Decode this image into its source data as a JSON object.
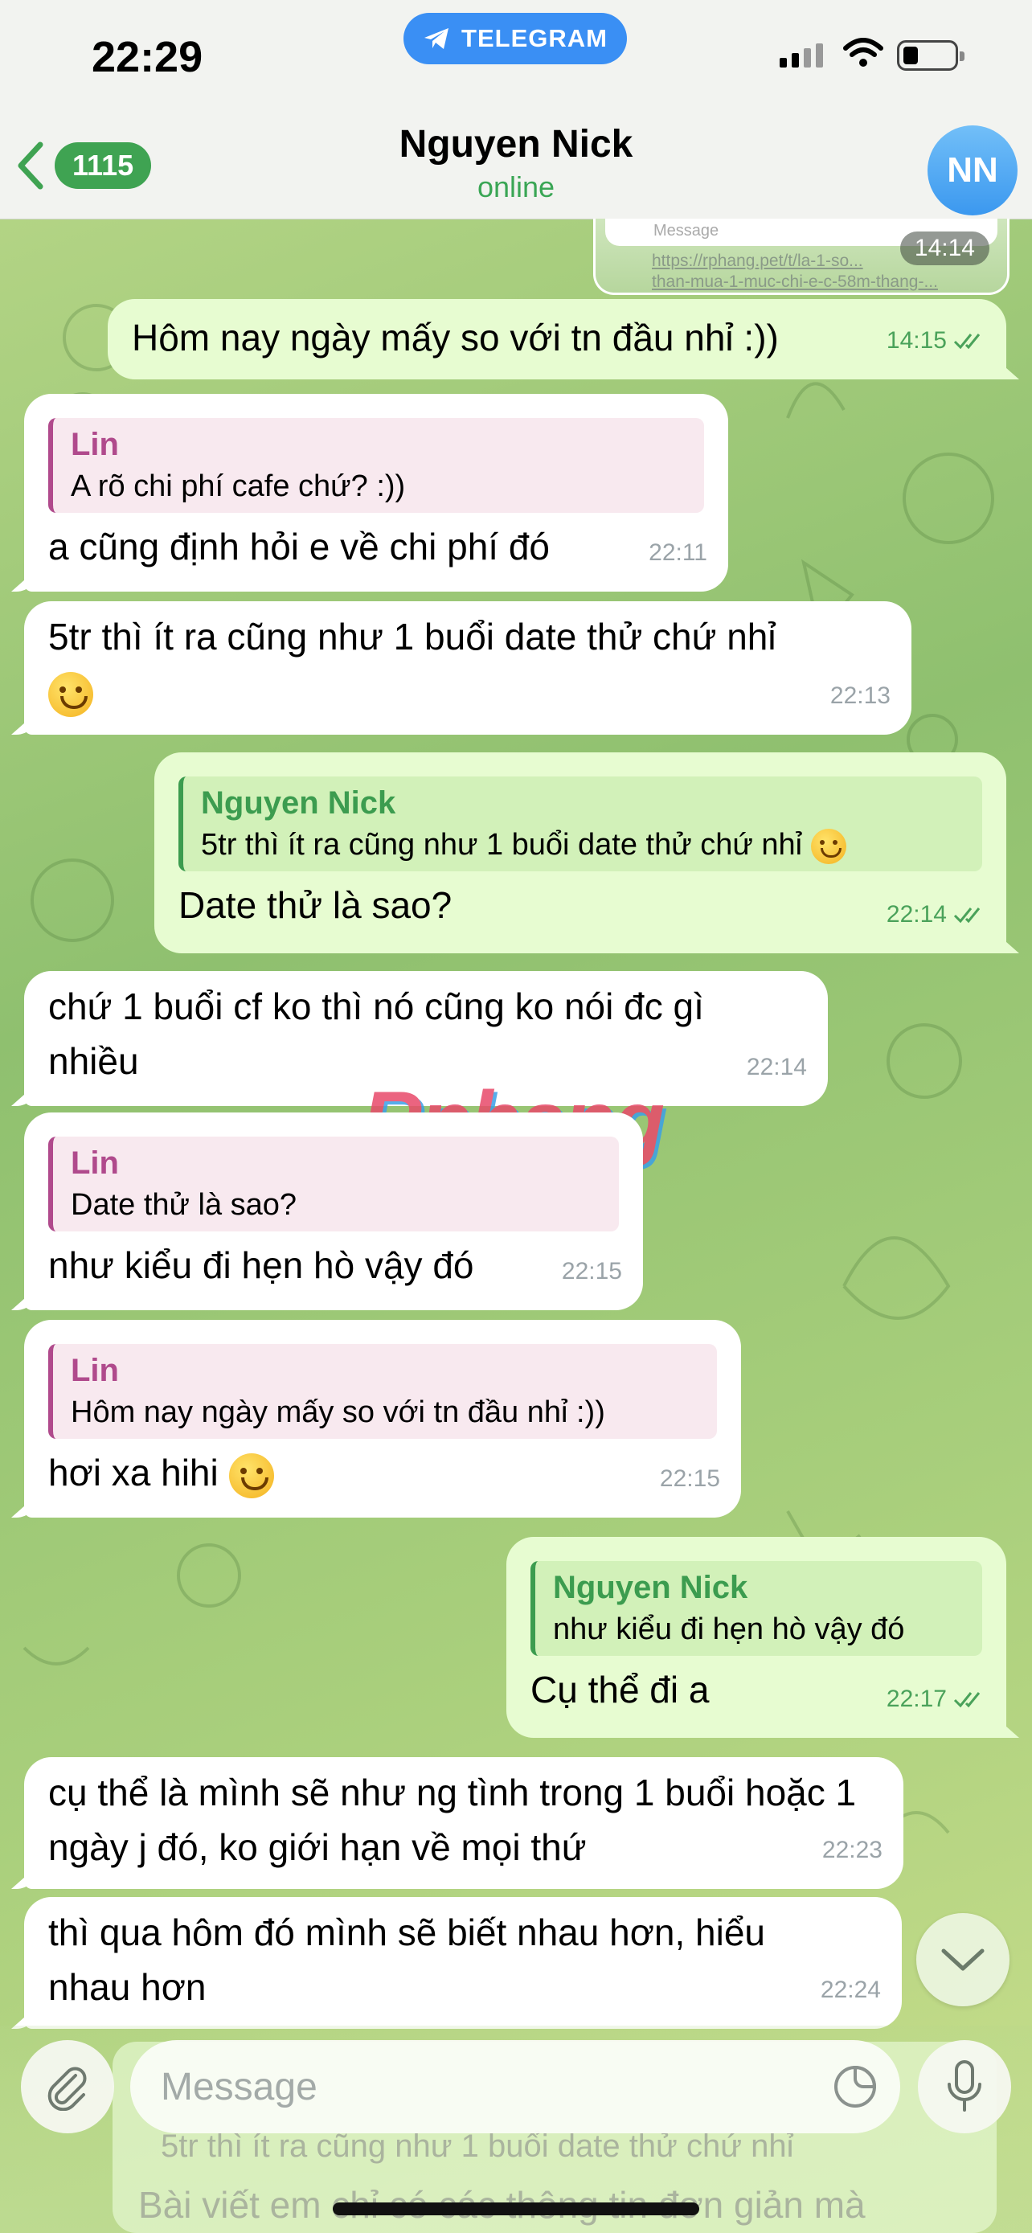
{
  "status_bar": {
    "time": "22:29",
    "app_pill": "TELEGRAM"
  },
  "header": {
    "back_count": "1115",
    "contact_name": "Nguyen Nick",
    "status": "online",
    "avatar_initials": "NN"
  },
  "preview": {
    "input_placeholder": "Message",
    "url_line1": "https://rphang.pet/t/la-1-so...",
    "url_line2": "than-mua-1-muc-chi-e-c-58m-thang-...",
    "time": "14:14"
  },
  "messages": [
    {
      "dir": "out",
      "text": "Hôm nay ngày mấy so với tn đầu nhỉ :))",
      "time": "14:15"
    },
    {
      "dir": "in",
      "reply_name": "Lin",
      "reply_text": "A rõ chi phí cafe chứ? :))",
      "text": "a cũng định hỏi e về chi phí đó",
      "time": "22:11"
    },
    {
      "dir": "in",
      "text": "5tr thì ít ra cũng như 1 buổi date thử chứ nhỉ",
      "time": "22:13"
    },
    {
      "dir": "out",
      "reply_name": "Nguyen Nick",
      "reply_text": "5tr thì ít ra cũng như 1 buổi date thử chứ nhỉ",
      "text": "Date thử là sao?",
      "time": "22:14"
    },
    {
      "dir": "in",
      "text": "chứ 1 buổi cf ko thì nó cũng ko nói đc gì nhiều",
      "time": "22:14"
    },
    {
      "dir": "in",
      "reply_name": "Lin",
      "reply_text": "Date thử là sao?",
      "text": "như kiểu đi hẹn hò vậy đó",
      "time": "22:15"
    },
    {
      "dir": "in",
      "reply_name": "Lin",
      "reply_text": "Hôm nay ngày mấy so với tn đầu nhỉ :))",
      "text": "hơi xa hihi",
      "time": "22:15"
    },
    {
      "dir": "out",
      "reply_name": "Nguyen Nick",
      "reply_text": "như kiểu đi hẹn hò vậy đó",
      "text": "Cụ thể đi a",
      "time": "22:17"
    },
    {
      "dir": "in",
      "text": "cụ thể là mình sẽ như ng tình trong 1 buổi hoặc 1 ngày j đó, ko giới hạn về mọi thứ",
      "time": "22:23"
    },
    {
      "dir": "in",
      "text": "thì qua hôm đó mình sẽ biết nhau hơn, hiểu nhau hơn",
      "time": "22:24"
    }
  ],
  "watermark": "Rphang",
  "composer": {
    "placeholder": "Message",
    "ghost_line1": "5tr thì ít ra cũng như 1 buổi date thử chứ nhỉ",
    "ghost_line2": "Bài viết em chỉ có các thông tin đơn giản mà"
  },
  "icons": [
    "telegram-icon",
    "signal-icon",
    "wifi-icon",
    "battery-icon",
    "back-chevron-icon",
    "double-check-icon",
    "smile-emoji-icon",
    "blush-emoji-icon",
    "chevron-down-icon",
    "paperclip-icon",
    "sticker-icon",
    "microphone-icon"
  ],
  "colors": {
    "outgoing": "#e7fcd1",
    "incoming": "#ffffff",
    "accent_green": "#3fa352",
    "reply_pink": "#b04a8c",
    "link_blue": "#3a8ff4"
  }
}
